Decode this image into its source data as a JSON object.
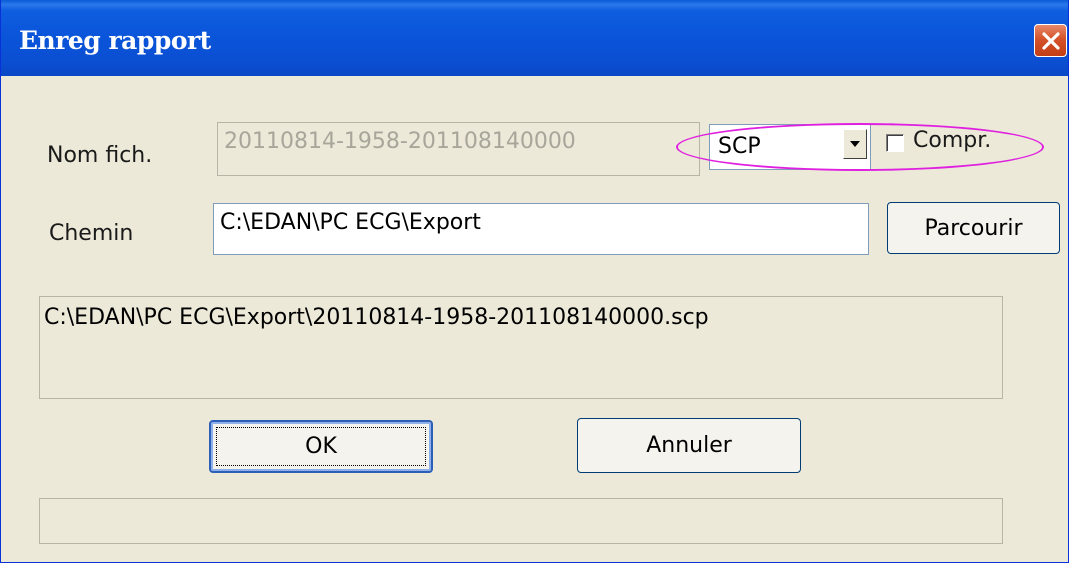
{
  "window": {
    "title": "Enreg rapport",
    "close_icon": "close-icon"
  },
  "form": {
    "filename_label": "Nom fich.",
    "filename_value": "20110814-1958-201108140000",
    "format_value": "SCP",
    "compress_label": "Compr.",
    "compress_checked": false,
    "path_label": "Chemin",
    "path_value": "C:\\EDAN\\PC ECG\\Export",
    "browse_label": "Parcourir",
    "full_path": "C:\\EDAN\\PC ECG\\Export\\20110814-1958-201108140000.scp"
  },
  "buttons": {
    "ok_label": "OK",
    "cancel_label": "Annuler"
  },
  "colors": {
    "titlebar": "#0a54d9",
    "dialog_background": "#ece9d8",
    "highlight": "#e020e0",
    "close_button": "#d5532a"
  }
}
